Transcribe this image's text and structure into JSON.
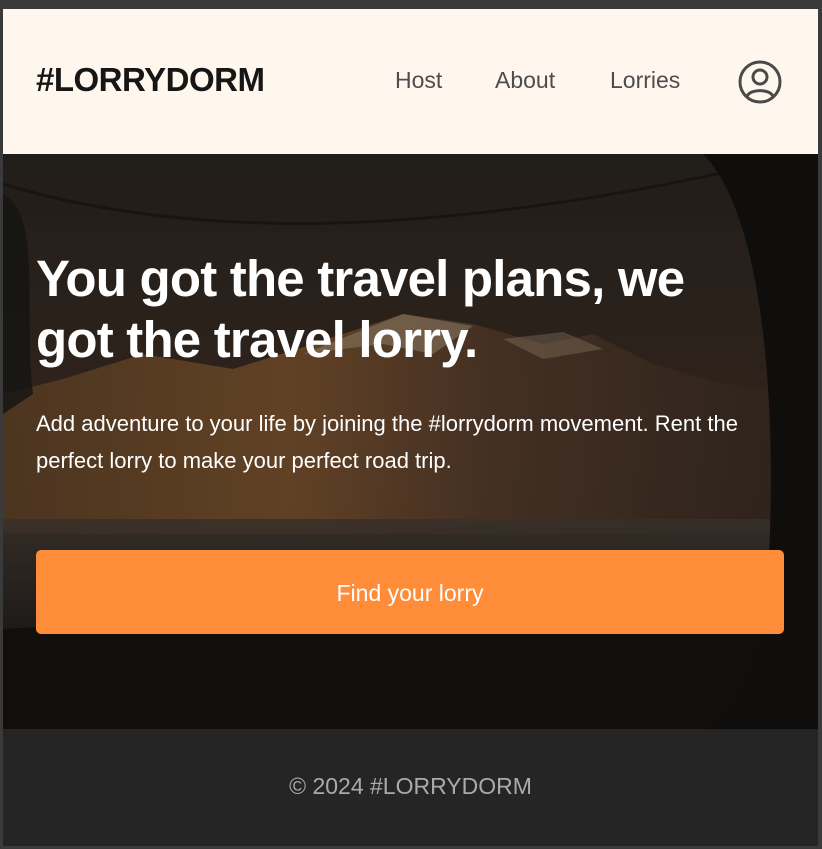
{
  "header": {
    "logo": "#LORRYDORM",
    "nav": [
      {
        "label": "Host"
      },
      {
        "label": "About"
      },
      {
        "label": "Lorries"
      }
    ],
    "avatar_icon": "user-circle-icon"
  },
  "hero": {
    "title": "You got the travel plans, we got the travel lorry.",
    "subtitle": "Add adventure to your life by joining the #lorrydorm movement. Rent the perfect lorry to make your perfect road trip.",
    "cta_label": "Find your lorry"
  },
  "footer": {
    "copyright": "© 2024 #LORRYDORM"
  },
  "colors": {
    "header_bg": "#fff7ed",
    "accent": "#ff8c38",
    "footer_bg": "#252525",
    "footer_text": "#aaaaaa"
  }
}
